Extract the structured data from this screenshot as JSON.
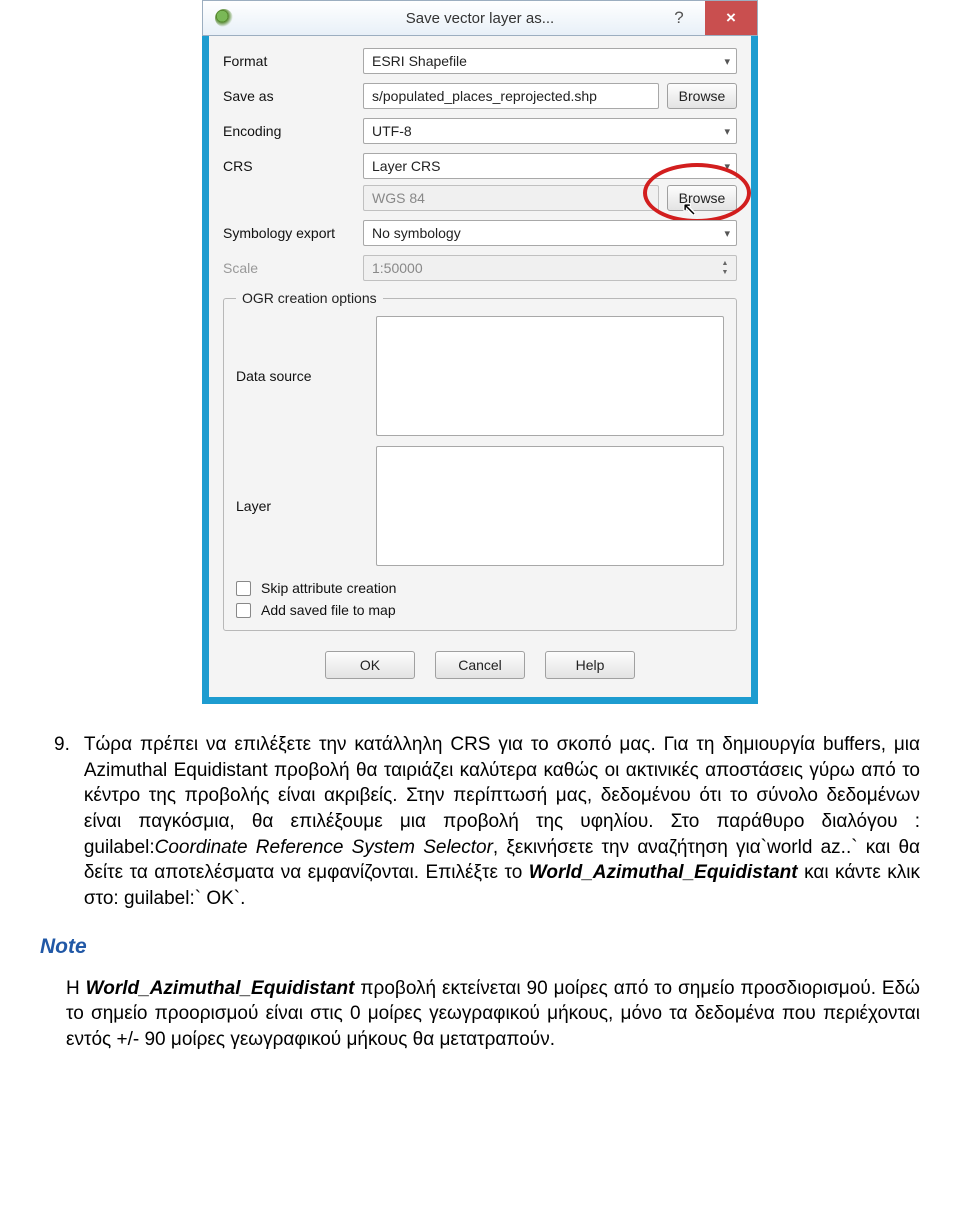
{
  "dialog": {
    "title": "Save vector layer as...",
    "help_symbol": "?",
    "close_symbol": "×",
    "labels": {
      "format": "Format",
      "save_as": "Save as",
      "encoding": "Encoding",
      "crs": "CRS",
      "symbology": "Symbology export",
      "scale": "Scale",
      "data_source": "Data source",
      "layer": "Layer"
    },
    "values": {
      "format": "ESRI Shapefile",
      "save_as": "s/populated_places_reprojected.shp",
      "encoding": "UTF-8",
      "crs_type": "Layer CRS",
      "crs_value": "WGS 84",
      "symbology": "No symbology",
      "scale": "1:50000"
    },
    "buttons": {
      "browse": "Browse",
      "browse2": "Browse",
      "ok": "OK",
      "cancel": "Cancel",
      "help": "Help"
    },
    "ogr_legend": "OGR creation options",
    "checkboxes": {
      "skip_attr": "Skip attribute creation",
      "add_saved": "Add saved file to map"
    }
  },
  "doc": {
    "item_number": "9.",
    "para_a": "Τώρα πρέπει να επιλέξετε την κατάλληλη CRS για το σκοπό μας. Για τη δημιουργία buffers, μια Azimuthal Equidistant προβολή θα ταιριάζει καλύτερα καθώς οι ακτινικές αποστάσεις γύρω από το κέντρο της προβολής είναι ακριβείς. Στην περίπτωσή μας, δεδομένου ότι το σύνολο δεδομένων είναι παγκόσμια, θα επιλέξουμε μια προβολή της υφηλίου. Στο παράθυρο διαλόγου :  guilabel:",
    "em_crs_sel": "Coordinate Reference System Selector",
    "para_b": ", ξεκινήσετε την αναζήτηση για`world az..` και θα δείτε τα αποτελέσματα να εμφανίζονται. Επιλέξτε το ",
    "em_wae": "World_Azimuthal_Equidistant",
    "para_c": " και κάντε κλικ στο: guilabel:` OK`.",
    "note_label": "Note",
    "note_a": "Η ",
    "note_em": "World_Azimuthal_Equidistant",
    "note_b": " προβολή εκτείνεται 90 μοίρες από το σημείο προσδιορισμού. Εδώ το σημείο προορισμού είναι στις 0 μοίρες γεωγραφικού μήκους, μόνο τα δεδομένα που περιέχονται εντός +/- 90 μοίρες γεωγραφικού μήκους θα μετατραπούν."
  }
}
